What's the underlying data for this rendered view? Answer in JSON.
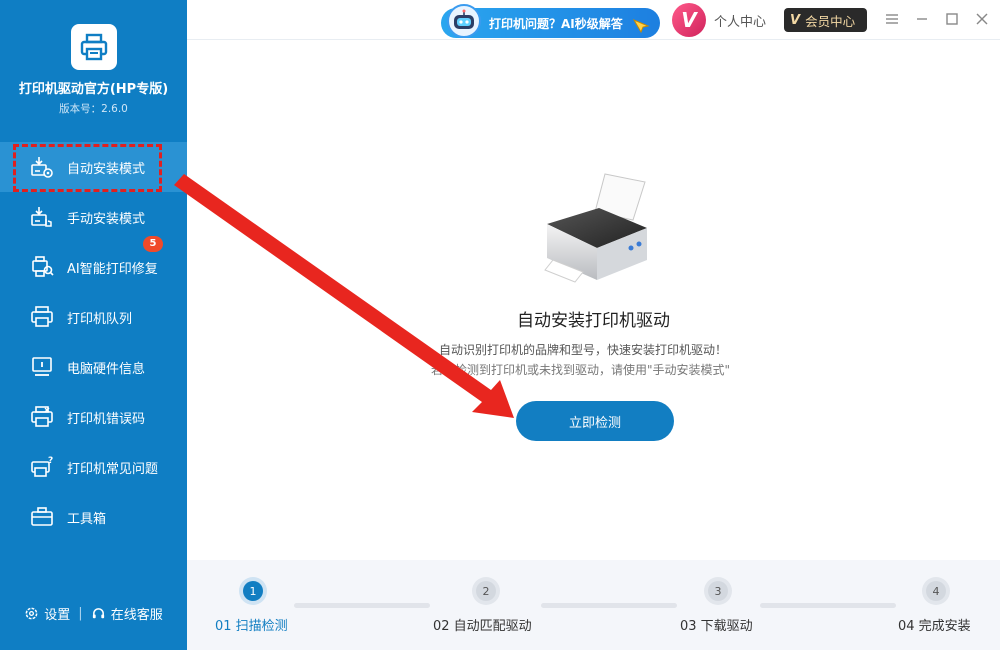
{
  "app": {
    "title": "打印机驱动官方(HP专版)",
    "version": "版本号：2.6.0"
  },
  "sidebar": {
    "items": [
      {
        "label": "自动安装模式",
        "icon": "auto-install-icon",
        "active": true
      },
      {
        "label": "手动安装模式",
        "icon": "manual-install-icon"
      },
      {
        "label": "AI智能打印修复",
        "icon": "ai-repair-icon",
        "badge": "5"
      },
      {
        "label": "打印机队列",
        "icon": "printer-queue-icon"
      },
      {
        "label": "电脑硬件信息",
        "icon": "hardware-info-icon"
      },
      {
        "label": "打印机错误码",
        "icon": "error-code-icon"
      },
      {
        "label": "打印机常见问题",
        "icon": "faq-icon"
      },
      {
        "label": "工具箱",
        "icon": "toolbox-icon"
      }
    ],
    "footer": {
      "settings": "设置",
      "support": "在线客服"
    }
  },
  "topbar": {
    "ai_banner": "打印机问题？AI秒级解答",
    "personal_center": "个人中心",
    "member_center": "会员中心",
    "vip_letter": "V"
  },
  "main": {
    "title": "自动安装打印机驱动",
    "desc_line1": "自动识别打印机的品牌和型号，快速安装打印机驱动！",
    "desc_line2": "若未检测到打印机或未找到驱动，请使用\"手动安装模式\"",
    "detect_button": "立即检测"
  },
  "steps": [
    {
      "number": "1",
      "label": "01 扫描检测",
      "active": true
    },
    {
      "number": "2",
      "label": "02 自动匹配驱动"
    },
    {
      "number": "3",
      "label": "03 下载驱动"
    },
    {
      "number": "4",
      "label": "04 完成安装"
    }
  ],
  "colors": {
    "sidebar_bg": "#0f7ec4",
    "accent": "#127ec2",
    "annotation_red": "#e02020",
    "badge": "#f04a2a"
  }
}
